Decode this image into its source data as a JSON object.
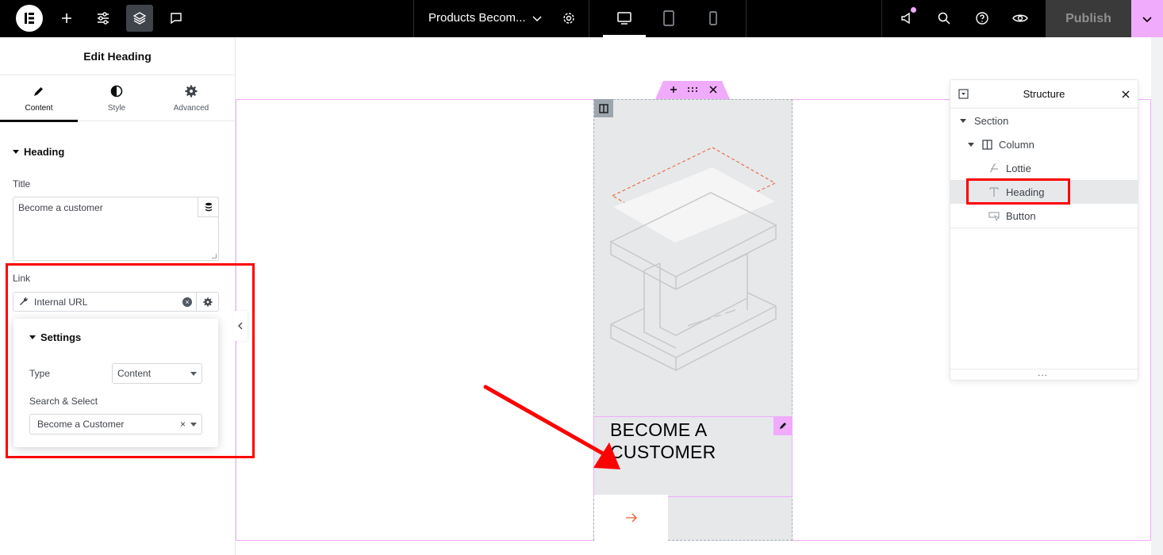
{
  "topbar": {
    "document_title": "Products Becom...",
    "publish_label": "Publish",
    "icons": [
      "elementor-logo-icon",
      "plus-icon",
      "sliders-icon",
      "layers-icon",
      "comment-icon",
      "chevron-down-icon",
      "gear-icon",
      "desktop-icon",
      "tablet-icon",
      "mobile-icon",
      "megaphone-icon",
      "search-icon",
      "help-icon",
      "eye-icon"
    ]
  },
  "panel": {
    "title": "Edit Heading",
    "tabs": [
      {
        "label": "Content",
        "icon": "pencil-icon",
        "active": true
      },
      {
        "label": "Style",
        "icon": "half-circle-icon"
      },
      {
        "label": "Advanced",
        "icon": "gear-icon"
      }
    ],
    "section": "Heading",
    "title_label": "Title",
    "title_value": "Become a customer",
    "link_label": "Link",
    "link_value": "Internal URL",
    "settings": {
      "heading": "Settings",
      "type_label": "Type",
      "type_value": "Content",
      "search_label": "Search & Select",
      "search_value": "Become a Customer",
      "clear_glyph": "×"
    }
  },
  "canvas": {
    "heading_text": "BECOME A CUSTOMER",
    "button_icon": "arrow-right-icon"
  },
  "structure": {
    "title": "Structure",
    "items": [
      {
        "label": "Section",
        "level": 0
      },
      {
        "label": "Column",
        "level": 1
      },
      {
        "label": "Lottie",
        "level": 2
      },
      {
        "label": "Heading",
        "level": 2,
        "selected": true
      },
      {
        "label": "Button",
        "level": 2
      }
    ],
    "more_glyph": "..."
  },
  "colors": {
    "accent": "#f0abfc",
    "annotation": "#ff0000",
    "button_arrow": "#f15a29"
  }
}
